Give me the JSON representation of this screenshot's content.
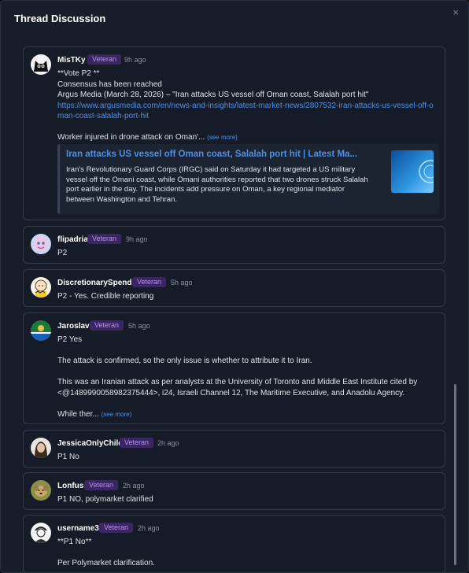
{
  "modal": {
    "title": "Thread Discussion",
    "close_icon": "×"
  },
  "colors": {
    "background": "#171d29",
    "card_border": "#343c4c",
    "badge_bg": "#3a2660",
    "badge_text": "#b88ff0",
    "link": "#4d8fe8"
  },
  "comments": [
    {
      "username": "MisTKy",
      "badge": "Veteran",
      "time": "9h ago",
      "avatar_icon": "black-cat-avatar",
      "lines": [
        "**Vote P2 **",
        "Consensus has been reached",
        "Argus Media (March 28, 2026) – \"Iran attacks US vessel off Oman coast, Salalah port hit\""
      ],
      "link": "https://www.argusmedia.com/en/news-and-insights/latest-market-news/2807532-iran-attacks-us-vessel-off-oman-coast-salalah-port-hit",
      "trailing": "Worker injured in drone attack on Oman'...",
      "see_more": "(see more)",
      "preview": {
        "title": "Iran attacks US vessel off Oman coast, Salalah port hit | Latest Ma...",
        "description": "Iran's Revolutionary Guard Corps (IRGC) said on Saturday it had targeted a US military vessel off the Omani coast, while Omani authorities reported that two drones struck Salalah port earlier in the day. The incidents add pressure on Oman, a key regional mediator between Washington and Tehran."
      }
    },
    {
      "username": "flipadria",
      "badge": "Veteran",
      "time": "9h ago",
      "avatar_icon": "pastel-creature-avatar",
      "text": "P2"
    },
    {
      "username": "DiscretionarySpender",
      "badge": "Veteran",
      "time": "5h ago",
      "avatar_icon": "cartoon-character-avatar",
      "text": "P2 - Yes.  Credible reporting"
    },
    {
      "username": "Jaroslav",
      "badge": "Veteran",
      "time": "5h ago",
      "avatar_icon": "flag-avatar",
      "lines": [
        "P2 Yes",
        "",
        "The attack is confirmed, so the only issue is whether to attribute it to Iran.",
        "",
        "This was an Iranian attack as per analysts at the University of Toronto and Middle East Institute cited by <@1489990058982375444>, i24, Israeli Channel 12, The Maritime Executive, and Anadolu Agency.",
        ""
      ],
      "trailing": "While ther...",
      "see_more": "(see more)"
    },
    {
      "username": "JessicaOnlyChild",
      "badge": "Veteran",
      "time": "2h ago",
      "avatar_icon": "portrait-avatar",
      "text": "P1 No"
    },
    {
      "username": "Lonfus",
      "badge": "Veteran",
      "time": "2h ago",
      "avatar_icon": "dog-avatar",
      "text": "P1 NO, polymarket clarified"
    },
    {
      "username": "username3",
      "badge": "Veteran",
      "time": "2h ago",
      "avatar_icon": "sketch-avatar",
      "lines": [
        "**P1 No**",
        "",
        "Per Polymarket clarification."
      ]
    }
  ]
}
